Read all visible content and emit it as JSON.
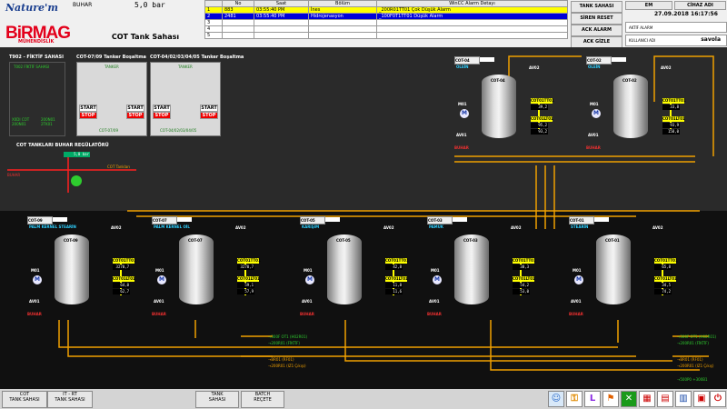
{
  "header": {
    "logo_top": "Nature'm",
    "logo_brand": "BiRMAG",
    "logo_sub": "MÜHENDİSLİK",
    "steam_label": "BUHAR",
    "steam_value": "5,0",
    "steam_unit": "bar",
    "page_title": "COT Tank Sahası"
  },
  "alarms": {
    "headers": {
      "no": "No",
      "time": "Saat",
      "area": "Bölüm",
      "detail": "WinCC Alarm Detayı"
    },
    "rows": [
      {
        "idx": "1",
        "no": "883",
        "time": "03:55:40 PM",
        "area": "İnes",
        "detail": "_200R01TT01 Çok Düşük Alarm"
      },
      {
        "idx": "2",
        "no": "2481",
        "time": "03:55:40 PM",
        "area": "Hidrojenasyon",
        "detail": "_100F0T1TT01 Düşük Alarm"
      },
      {
        "idx": "3"
      },
      {
        "idx": "4"
      },
      {
        "idx": "5"
      }
    ]
  },
  "right_buttons": {
    "tank_sahasi": "TANK SAHASI",
    "siren_reset": "SİREN RESET",
    "ack_alarm": "ACK ALARM",
    "ack_gizle": "ACK GİZLE"
  },
  "info": {
    "em": "EM",
    "cihaz_adi": "CİHAZ ADI",
    "datetime": "27.09.2018 16:17:56",
    "aktif_alarm": "AKTİF ALARM",
    "user_label": "KULLANICI ADI",
    "user": "savola"
  },
  "sections": {
    "t902": "T902 - FİKTİF SAHASI",
    "t902_sub": "T002 FİKTİF SAHASI",
    "t902_a": "X0DI COT 200N01",
    "t902_b": "200N01 2TK01",
    "cot0709": "COT-07/09 Tanker Boşaltma",
    "cot0709_sub": "TANKER",
    "cot0709_bottom": "COT-07/09",
    "cot0406": "COT-04/02/03/04/05 Tanker Boşaltma",
    "cot0406_sub": "TANKER",
    "cot0406_bottom": "COT-04/02/03/04/05",
    "start": "START",
    "stop": "STOP",
    "reg_title": "COT TANKLARI BUHAR REGÜLATÖRÜ",
    "reg_value": "5,0",
    "reg_unit": "bar",
    "reg_out": "COT Tankları",
    "reg_in": "BUHAR"
  },
  "tanks_top": [
    {
      "id": "COT-04",
      "product": "OLEİN",
      "name": "COT-04",
      "t1": "39,2",
      "t2": "95,2",
      "t3": "93,2",
      "unit1": "°C",
      "unit2": "%",
      "unit3": "ton"
    },
    {
      "id": "COT-02",
      "product": "OLEİN",
      "name": "COT-02",
      "t1": "33,8",
      "t2": "93,9",
      "t3": "158,0",
      "unit1": "°C",
      "unit2": "%",
      "unit3": "ton"
    }
  ],
  "tanks_bottom": [
    {
      "id": "COT-09",
      "product": "PALM KERNEL STEARİN",
      "name": "COT-09",
      "t1": "3270,7",
      "t2": "64,0",
      "t3": "62,7"
    },
    {
      "id": "COT-07",
      "product": "PALM KERNEL OİL",
      "name": "COT-07",
      "t1": "3270,7",
      "t2": "59,1",
      "t3": "57,9"
    },
    {
      "id": "COT-05",
      "product": "KARIŞIM",
      "name": "COT-05",
      "t1": "42,8",
      "t2": "11,8",
      "t3": "11,6"
    },
    {
      "id": "COT-03",
      "product": "PAMUK",
      "name": "COT-03",
      "t1": "38,3",
      "t2": "54,2",
      "t3": "53,0"
    },
    {
      "id": "COT-01",
      "product": "STEARİN",
      "name": "COT-01",
      "t1": "65,8",
      "t2": "34,5",
      "t3": "74,2"
    }
  ],
  "labels": {
    "av01": "AV01",
    "av02": "AV02",
    "m01": "M01",
    "buhar": "BUHAR",
    "cot_tt": "COT01TT01",
    "cot_lt": "COT01LT01",
    "ton": "ton",
    "deg": "°C",
    "pct": "%"
  },
  "outputs": {
    "left1": "→300F OT1 (H02R01)",
    "left2": "→200R01 (FİKTİF)",
    "left3": "→BR01 (RF01)",
    "left4": "→200R01 (IZ1 Çıkışı)",
    "right1": "→300F OT1 (H02R01)",
    "right2": "→200R01 (FİKTİF)",
    "right3": "→BR01 (RF01)",
    "right4": "→200R01 (IZ1 Çıkış)",
    "right5": "→500P0 +300B1"
  },
  "bottom": {
    "b1": "COT\nTANK SAHASI",
    "b2": "IT - RT\nTANK SAHASI",
    "b3": "TANK\nSAHASI",
    "b4": "BATCH\nREÇETE"
  },
  "colors": {
    "pipe": "#f0a000",
    "tt_box": "#ffff00",
    "alarm_row1": "#ffff00",
    "alarm_row2": "#0000d8"
  }
}
